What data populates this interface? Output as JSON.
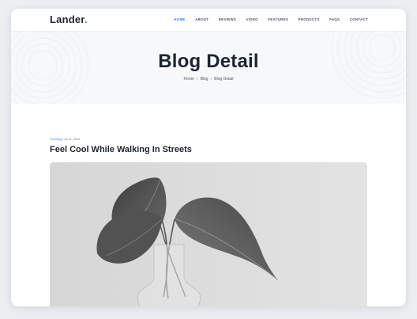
{
  "brand": {
    "name": "Lander",
    "dot": "."
  },
  "nav": {
    "items": [
      {
        "label": "HOME",
        "active": true
      },
      {
        "label": "ABOUT",
        "active": false
      },
      {
        "label": "REVIEWS",
        "active": false
      },
      {
        "label": "VIDEO",
        "active": false
      },
      {
        "label": "FEATURES",
        "active": false
      },
      {
        "label": "PRODUCTS",
        "active": false
      },
      {
        "label": "FAQS",
        "active": false
      },
      {
        "label": "CONTACT",
        "active": false
      }
    ]
  },
  "hero": {
    "title": "Blog Detail",
    "breadcrumb": {
      "home": "Home",
      "sep1": "›",
      "blog": "Blog",
      "sep2": "›",
      "current": "Blog Detail"
    }
  },
  "post": {
    "category": "Trending",
    "divider": "|",
    "date": "Jul 11, 2022",
    "title": "Feel Cool While Walking In Streets",
    "image_icon": "plant-in-vase-photo"
  },
  "colors": {
    "accent": "#2f80ed",
    "heading": "#1d2433",
    "hero_bg": "#f7f8fa"
  }
}
